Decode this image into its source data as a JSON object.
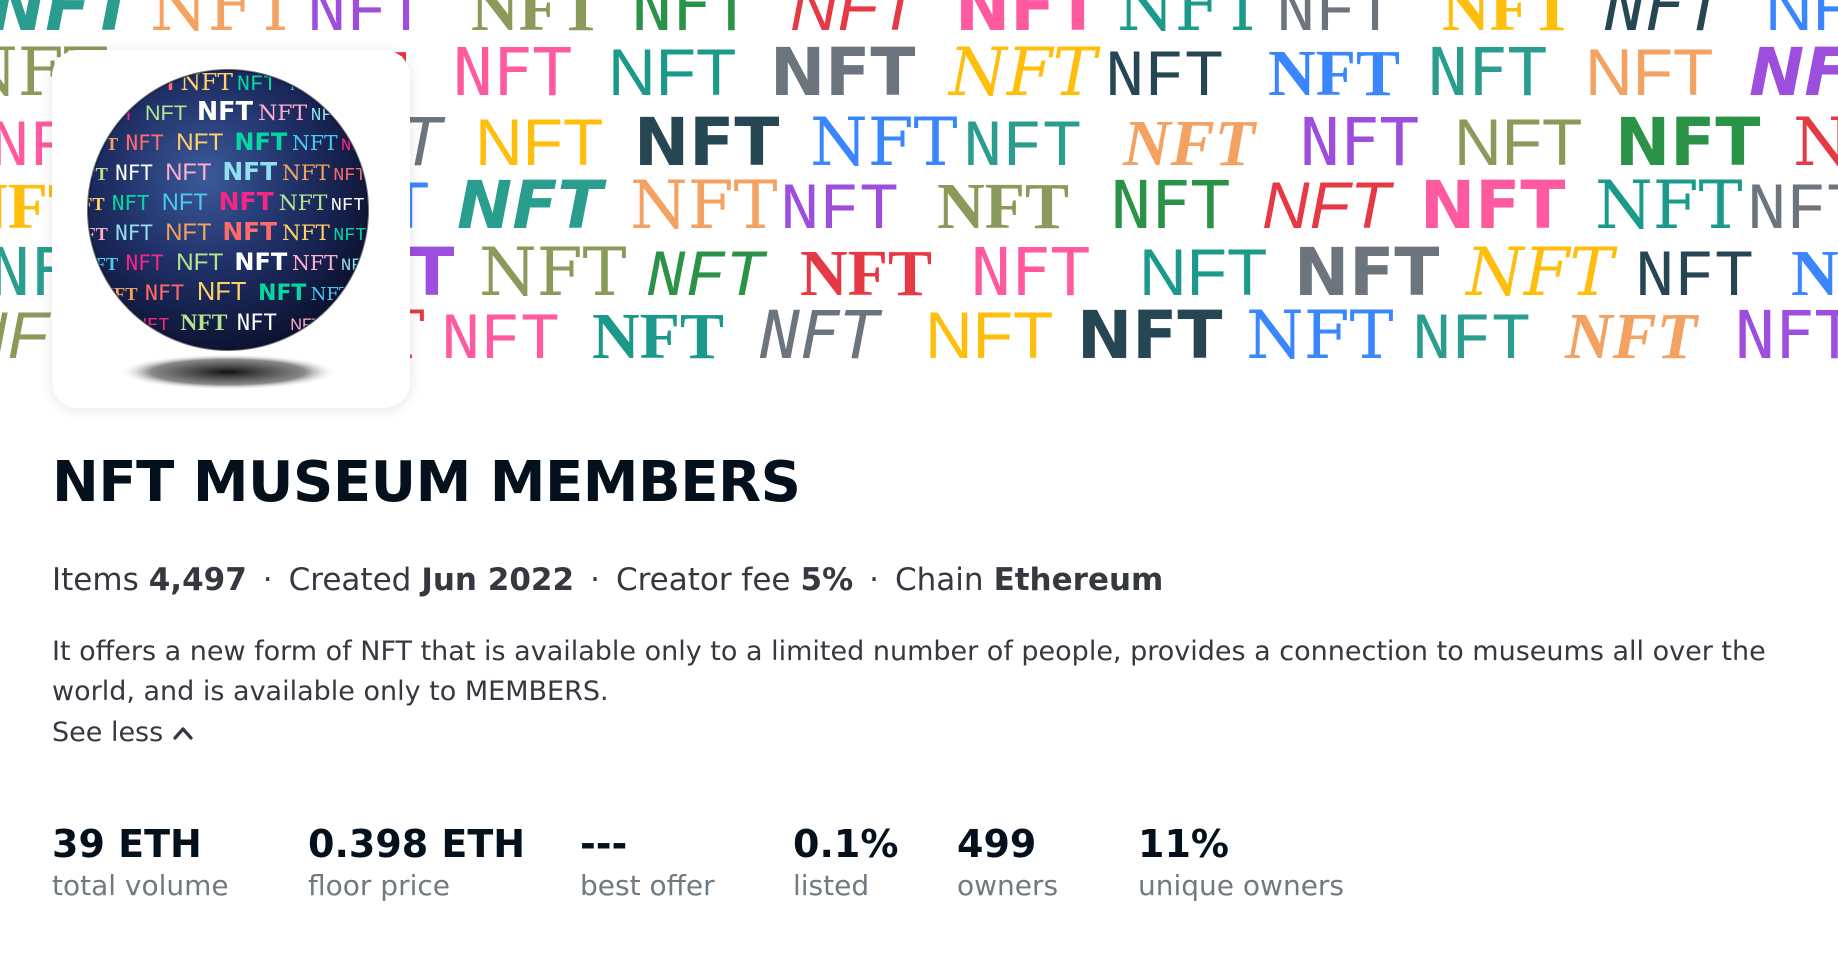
{
  "banner": {
    "word": "NFT",
    "colors": [
      "#2a9d8f",
      "#e63946",
      "#264653",
      "#8a9a5b",
      "#6c757d",
      "#f4a261",
      "#ff5aa0",
      "#3a86ff",
      "#2b9348",
      "#ffbe0b",
      "#9d4edd",
      "#1b998b"
    ]
  },
  "avatar": {
    "alt_word": "NFT"
  },
  "collection": {
    "title": "NFT MUSEUM MEMBERS"
  },
  "meta": [
    {
      "label": "Items",
      "value": "4,497"
    },
    {
      "label": "Created",
      "value": "Jun 2022"
    },
    {
      "label": "Creator fee",
      "value": "5%"
    },
    {
      "label": "Chain",
      "value": "Ethereum"
    }
  ],
  "description": "It offers a new form of NFT that is available only to a limited number of people, provides a connection to museums all over the world, and is available only to MEMBERS.",
  "see_less_label": "See less",
  "stats": [
    {
      "value": "39 ETH",
      "label": "total volume"
    },
    {
      "value": "0.398 ETH",
      "label": "floor price"
    },
    {
      "value": "---",
      "label": "best offer"
    },
    {
      "value": "0.1%",
      "label": "listed"
    },
    {
      "value": "499",
      "label": "owners"
    },
    {
      "value": "11%",
      "label": "unique owners"
    }
  ]
}
